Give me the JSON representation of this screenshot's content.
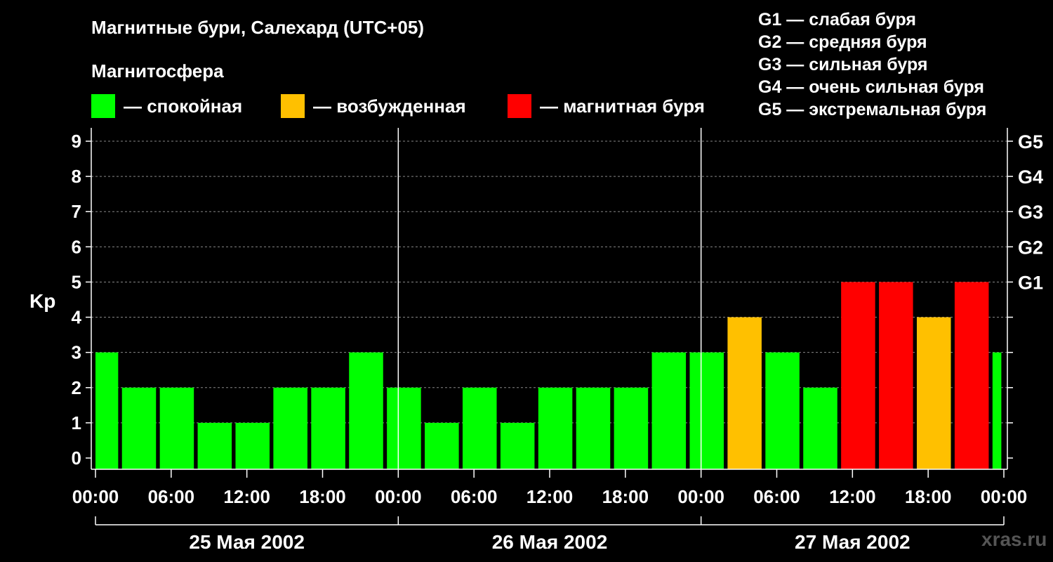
{
  "title": "Магнитные бури, Салехард (UTC+05)",
  "legend": {
    "heading": "Магнитосфера",
    "items": [
      {
        "label": "— спокойная",
        "color": "#00ff00"
      },
      {
        "label": "— возбужденная",
        "color": "#ffc000"
      },
      {
        "label": "— магнитная буря",
        "color": "#ff0000"
      }
    ]
  },
  "g_levels": [
    "G1 — слабая буря",
    "G2 — средняя буря",
    "G3 — сильная буря",
    "G4 — очень сильная буря",
    "G5 — экстремальная буря"
  ],
  "watermark": "xras.ru",
  "colors": {
    "quiet": "#00ff00",
    "active": "#ffc000",
    "storm": "#ff0000",
    "background": "#000000",
    "foreground": "#ffffff",
    "grid": "#888888"
  },
  "chart_data": {
    "type": "bar",
    "ylabel": "Kp",
    "ylim": [
      0,
      9
    ],
    "yticks": [
      "0",
      "1",
      "2",
      "3",
      "4",
      "5",
      "6",
      "7",
      "8",
      "9"
    ],
    "right_ticks": [
      {
        "value": 5,
        "label": "G1"
      },
      {
        "value": 6,
        "label": "G2"
      },
      {
        "value": 7,
        "label": "G3"
      },
      {
        "value": 8,
        "label": "G4"
      },
      {
        "value": 9,
        "label": "G5"
      }
    ],
    "xlim_hours": [
      0,
      72
    ],
    "x_tick_labels": [
      "00:00",
      "06:00",
      "12:00",
      "18:00",
      "00:00",
      "06:00",
      "12:00",
      "18:00",
      "00:00",
      "06:00",
      "12:00",
      "18:00",
      "00:00"
    ],
    "dates": [
      "25 Мая 2002",
      "26 Мая 2002",
      "27 Мая 2002"
    ],
    "grid": true,
    "bars": [
      {
        "start": 0,
        "end": 1.8,
        "kp": 3,
        "level": "quiet"
      },
      {
        "start": 2.1,
        "end": 4.8,
        "kp": 2,
        "level": "quiet"
      },
      {
        "start": 5.1,
        "end": 7.8,
        "kp": 2,
        "level": "quiet"
      },
      {
        "start": 8.1,
        "end": 10.8,
        "kp": 1,
        "level": "quiet"
      },
      {
        "start": 11.1,
        "end": 13.8,
        "kp": 1,
        "level": "quiet"
      },
      {
        "start": 14.1,
        "end": 16.8,
        "kp": 2,
        "level": "quiet"
      },
      {
        "start": 17.1,
        "end": 19.8,
        "kp": 2,
        "level": "quiet"
      },
      {
        "start": 20.1,
        "end": 22.8,
        "kp": 3,
        "level": "quiet"
      },
      {
        "start": 23.1,
        "end": 25.8,
        "kp": 2,
        "level": "quiet"
      },
      {
        "start": 26.1,
        "end": 28.8,
        "kp": 1,
        "level": "quiet"
      },
      {
        "start": 29.1,
        "end": 31.8,
        "kp": 2,
        "level": "quiet"
      },
      {
        "start": 32.1,
        "end": 34.8,
        "kp": 1,
        "level": "quiet"
      },
      {
        "start": 35.1,
        "end": 37.8,
        "kp": 2,
        "level": "quiet"
      },
      {
        "start": 38.1,
        "end": 40.8,
        "kp": 2,
        "level": "quiet"
      },
      {
        "start": 41.1,
        "end": 43.8,
        "kp": 2,
        "level": "quiet"
      },
      {
        "start": 44.1,
        "end": 46.8,
        "kp": 3,
        "level": "quiet"
      },
      {
        "start": 47.1,
        "end": 49.8,
        "kp": 3,
        "level": "quiet"
      },
      {
        "start": 50.1,
        "end": 52.8,
        "kp": 4,
        "level": "active"
      },
      {
        "start": 53.1,
        "end": 55.8,
        "kp": 3,
        "level": "quiet"
      },
      {
        "start": 56.1,
        "end": 58.8,
        "kp": 2,
        "level": "quiet"
      },
      {
        "start": 59.1,
        "end": 61.8,
        "kp": 5,
        "level": "storm"
      },
      {
        "start": 62.1,
        "end": 64.8,
        "kp": 5,
        "level": "storm"
      },
      {
        "start": 65.1,
        "end": 67.8,
        "kp": 4,
        "level": "active"
      },
      {
        "start": 68.1,
        "end": 70.8,
        "kp": 5,
        "level": "storm"
      },
      {
        "start": 71.1,
        "end": 71.8,
        "kp": 3,
        "level": "quiet"
      }
    ]
  }
}
